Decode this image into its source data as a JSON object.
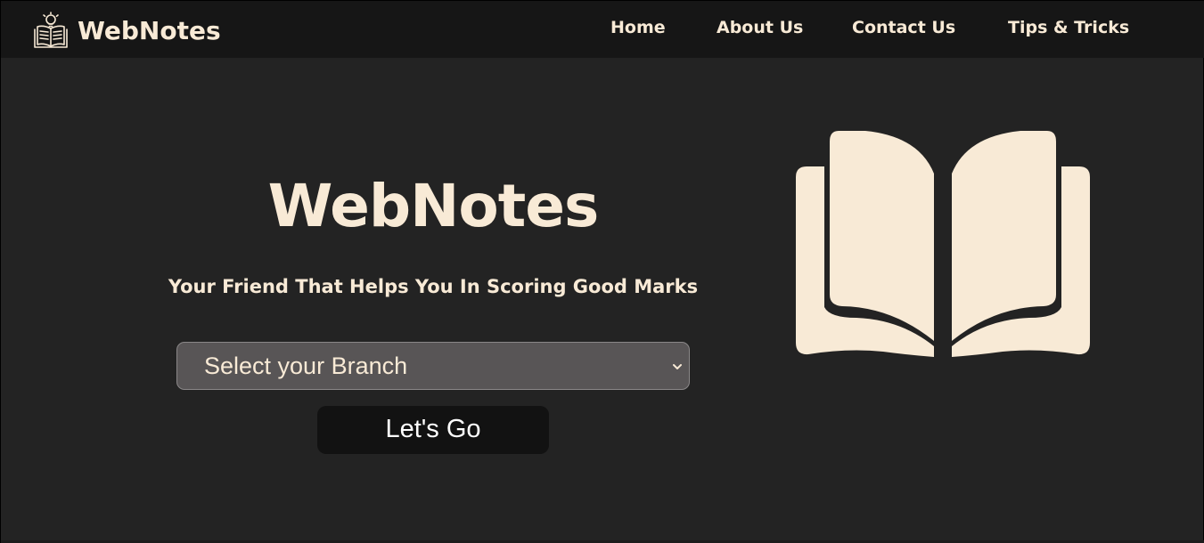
{
  "brand": {
    "name": "WebNotes",
    "icon": "book-lightbulb-icon"
  },
  "nav": {
    "items": [
      {
        "label": "Home"
      },
      {
        "label": "About Us"
      },
      {
        "label": "Contact Us"
      },
      {
        "label": "Tips & Tricks"
      }
    ]
  },
  "hero": {
    "title": "WebNotes",
    "subtitle": "Your Friend That Helps You In Scoring Good Marks",
    "branch_select": {
      "selected": "Select your Branch"
    },
    "go_button_label": "Let's Go",
    "illustration": "open-book-icon"
  },
  "colors": {
    "background": "#232323",
    "navbar": "#161616",
    "cream": "#f8ead6",
    "select_bg": "#585556",
    "button_bg": "#121212"
  }
}
